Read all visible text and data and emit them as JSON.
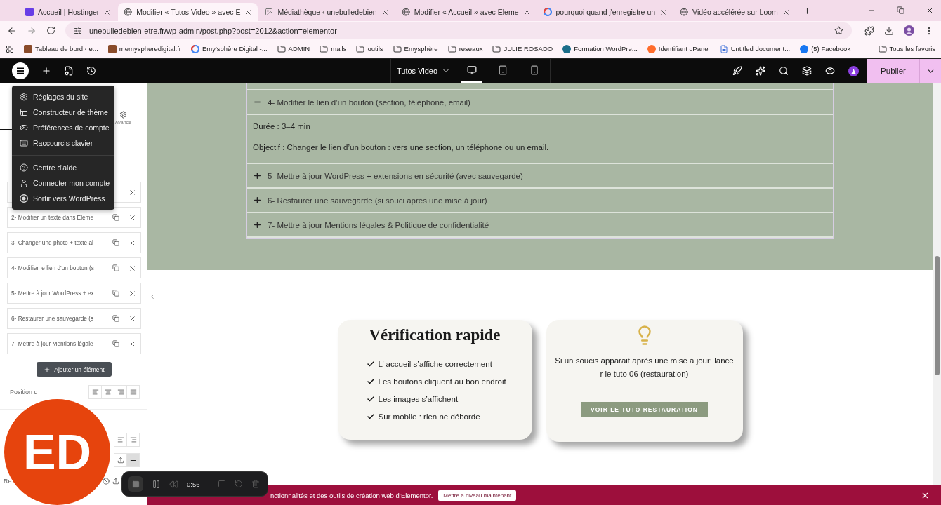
{
  "browser": {
    "tabs": [
      {
        "title": "Accueil | Hostinger",
        "kind": "hostinger",
        "selected": false
      },
      {
        "title": "Modifier « Tutos Video » avec E",
        "kind": "globe",
        "selected": true
      },
      {
        "title": "Médiathèque ‹ unebulledebien",
        "kind": "media",
        "selected": false
      },
      {
        "title": "Modifier « Accueil » avec Eleme",
        "kind": "globe",
        "selected": false
      },
      {
        "title": "pourquoi quand j'enregistre un",
        "kind": "google",
        "selected": false
      },
      {
        "title": "Vidéo accélérée sur Loom",
        "kind": "globe",
        "selected": false
      }
    ],
    "url": "unebulledebien-etre.fr/wp-admin/post.php?post=2012&action=elementor",
    "bookmarks": [
      {
        "label": "Tableau de bord ‹ e...",
        "kind": "square"
      },
      {
        "label": "memyspheredigital.fr",
        "kind": "square"
      },
      {
        "label": "Emy'sphère Digital -...",
        "kind": "google"
      },
      {
        "label": "ADMIN",
        "kind": "folder"
      },
      {
        "label": "mails",
        "kind": "folder"
      },
      {
        "label": "outils",
        "kind": "folder"
      },
      {
        "label": "Emysphère",
        "kind": "folder"
      },
      {
        "label": "reseaux",
        "kind": "folder"
      },
      {
        "label": "JULIE ROSADO",
        "kind": "folder"
      },
      {
        "label": "Formation WordPre...",
        "kind": "circle"
      },
      {
        "label": "Identifiant cPanel",
        "kind": "cpanel"
      },
      {
        "label": "Untitled document...",
        "kind": "document"
      },
      {
        "label": "(5) Facebook",
        "kind": "facebook"
      }
    ],
    "all_bookmarks": "Tous les favoris"
  },
  "editor": {
    "page_title": "Tutos Video",
    "devices": [
      {
        "kind": "desktop",
        "selected": true
      },
      {
        "kind": "tablet",
        "selected": false
      },
      {
        "kind": "mobile",
        "selected": false
      }
    ],
    "publish": "Publier"
  },
  "site_menu": {
    "groups": [
      {
        "items": [
          {
            "label": "Réglages du site",
            "kind": "gear"
          },
          {
            "label": "Constructeur de thème",
            "kind": "theme"
          },
          {
            "label": "Préférences de compte",
            "kind": "toggle"
          },
          {
            "label": "Raccourcis clavier",
            "kind": "keyboard"
          }
        ]
      },
      {
        "items": [
          {
            "label": "Centre d'aide",
            "kind": "help"
          },
          {
            "label": "Connecter mon compte",
            "kind": "user"
          },
          {
            "label": "Sortir vers WordPress",
            "kind": "wordpress"
          }
        ]
      }
    ]
  },
  "panel": {
    "tab": "Avancé",
    "items": [
      "2- Modifier un texte dans Eleme",
      "3- Changer une photo + texte al",
      "4- Modifier le lien d'un bouton (s",
      "5- Mettre à jour WordPress + ex",
      "6- Restaurer une sauvegarde (s",
      "7- Mettre à jour Mentions légale"
    ],
    "add_button": "Ajouter un élément",
    "position_label": "Position d",
    "label_2": "Re"
  },
  "accordion": [
    {
      "label": "4- Modifier le lien d’un bouton (section, téléphone, email)",
      "expanded": true,
      "details": [
        "Durée : 3–4 min",
        "Objectif : Changer le lien d’un bouton : vers une section, un téléphone ou un email."
      ]
    },
    {
      "label": "5- Mettre à jour WordPress + extensions en sécurité (avec sauvegarde)",
      "expanded": false
    },
    {
      "label": "6- Restaurer une sauvegarde (si souci après une mise à jour)",
      "expanded": false
    },
    {
      "label": "7- Mettre à jour Mentions légales & Politique de confidentialité",
      "expanded": false
    }
  ],
  "quick_check": {
    "title": "Vérification rapide",
    "items": [
      "L’ accueil s’affiche correctement",
      "Les boutons cliquent au bon endroit",
      "Les images s’affichent",
      "Sur mobile : rien ne déborde"
    ]
  },
  "tip_card": {
    "text": "Si un soucis apparait après une mise à jour: lance r le tuto 06 (restauration)",
    "button": "VOIR LE TUTO RESTAURATION"
  },
  "recorder": {
    "time": "0:56",
    "avatar_initials": "ED"
  },
  "upgrade_banner": {
    "text": "nctionnalités et des outils de création web d’Elementor.",
    "button": "Mettre à niveau maintenant"
  }
}
